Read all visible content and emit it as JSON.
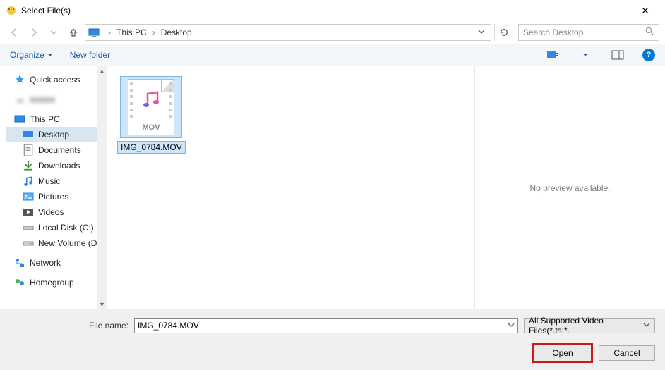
{
  "title": "Select File(s)",
  "breadcrumb": {
    "loc1": "This PC",
    "loc2": "Desktop"
  },
  "search": {
    "placeholder": "Search Desktop"
  },
  "toolbar": {
    "organize": "Organize",
    "new_folder": "New folder"
  },
  "sidebar": {
    "quick_access": "Quick access",
    "this_pc": "This PC",
    "desktop": "Desktop",
    "documents": "Documents",
    "downloads": "Downloads",
    "music": "Music",
    "pictures": "Pictures",
    "videos": "Videos",
    "local_disk": "Local Disk (C:)",
    "new_volume": "New Volume (D:)",
    "network": "Network",
    "homegroup": "Homegroup"
  },
  "file": {
    "name": "IMG_0784.MOV",
    "badge": "MOV"
  },
  "preview": {
    "empty": "No preview available."
  },
  "footer": {
    "label": "File name:",
    "value": "IMG_0784.MOV",
    "filter": "All Supported Video Files(*.ts;*.",
    "open": "Open",
    "cancel": "Cancel"
  }
}
